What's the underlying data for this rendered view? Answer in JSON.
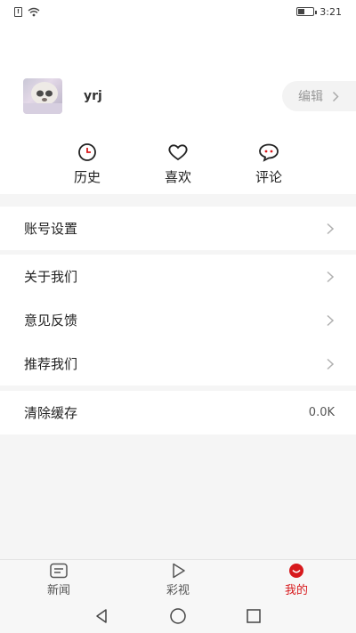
{
  "status_bar": {
    "time": "3:21"
  },
  "profile": {
    "username": "yrj",
    "edit_label": "编辑"
  },
  "quick_actions": [
    {
      "label": "历史",
      "icon": "clock-icon"
    },
    {
      "label": "喜欢",
      "icon": "heart-icon"
    },
    {
      "label": "评论",
      "icon": "comment-icon"
    }
  ],
  "settings": {
    "account": "账号设置",
    "about": "关于我们",
    "feedback": "意见反馈",
    "recommend": "推荐我们",
    "clear_cache": "清除缓存",
    "cache_size": "0.0K"
  },
  "bottom_nav": [
    {
      "label": "新闻",
      "icon": "news-icon",
      "active": false
    },
    {
      "label": "彩视",
      "icon": "play-icon",
      "active": false
    },
    {
      "label": "我的",
      "icon": "smile-icon",
      "active": true
    }
  ],
  "colors": {
    "accent": "#d7191c",
    "muted": "#999999"
  }
}
